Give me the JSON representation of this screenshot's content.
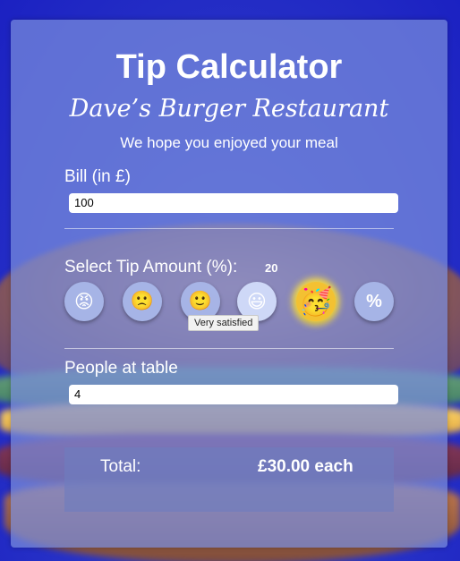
{
  "app": {
    "title": "Tip Calculator",
    "restaurant": "Dave’s Burger Restaurant",
    "subtitle": "We hope you enjoyed your meal"
  },
  "bill": {
    "label": "Bill (in £)",
    "value": "100"
  },
  "tip": {
    "label": "Select Tip Amount (%):",
    "value": "20",
    "options": [
      {
        "icon": "angry-face-icon",
        "glyph": "😡"
      },
      {
        "icon": "slightly-frowning-face-icon",
        "glyph": "🙁"
      },
      {
        "icon": "slightly-smiling-face-icon",
        "glyph": "🙂"
      },
      {
        "icon": "grinning-face-icon",
        "glyph": "😃"
      },
      {
        "icon": "partying-face-icon",
        "glyph": "🥳"
      },
      {
        "icon": "percent-icon",
        "glyph": "%"
      }
    ],
    "selected_index": 4,
    "tooltip": "Very satisfied"
  },
  "people": {
    "label": "People at table",
    "value": "4"
  },
  "total": {
    "label": "Total:",
    "value": "£30.00 each"
  },
  "colors": {
    "background": "#2a36c8",
    "card": "#788cdc",
    "selected_glow": "#ffe13c"
  }
}
